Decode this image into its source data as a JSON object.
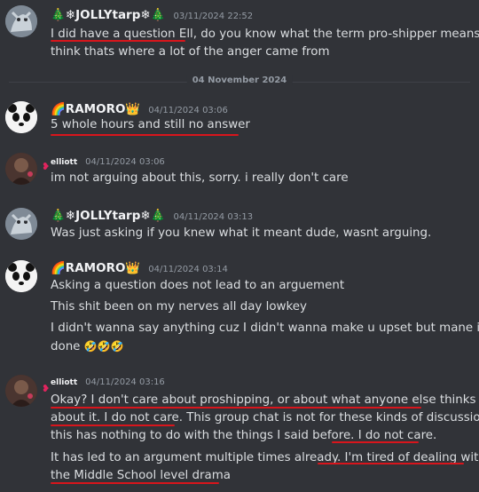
{
  "messages": [
    {
      "username": "🎄❄JOLLYtarp❄🎄",
      "timestamp": "03/11/2024 22:52",
      "lines": [
        "I did have a question Ell, do you know what the term pro-shipper means? I",
        "think thats where a lot of the anger came from"
      ]
    },
    {
      "username": "🌈RAMORO👑",
      "timestamp": "04/11/2024 03:06",
      "lines": [
        "5 whole hours and still no answer"
      ]
    },
    {
      "username": "elliott",
      "timestamp": "04/11/2024 03:06",
      "lines": [
        "im not arguing about this, sorry. i really don't care"
      ]
    },
    {
      "username": "🎄❄JOLLYtarp❄🎄",
      "timestamp": "04/11/2024 03:13",
      "lines": [
        "Was just asking if you knew what it meant dude, wasnt arguing."
      ]
    },
    {
      "username": "🌈RAMORO👑",
      "timestamp": "04/11/2024 03:14",
      "lines": [
        "Asking a question does not lead to an arguement",
        "This shit been on my nerves all day lowkey",
        "I didn't wanna say anything cuz I didn't wanna make u upset but mane im",
        "done"
      ],
      "trailing_emoji": "🤣🤣🤣"
    },
    {
      "username": "elliott",
      "timestamp": "04/11/2024 03:16",
      "lines": [
        "Okay? I don't care about proshipping, or about what anyone else thinks",
        "about it. I do not care. This group chat is not for these kinds of discussions,",
        "this has nothing to do with the things I said before. I do not care.",
        "It has led to an argument multiple times already. I'm tired of dealing with",
        "the Middle School level drama"
      ]
    }
  ],
  "date_divider": "04 November 2024",
  "colors": {
    "background": "#313338",
    "text": "#dbdee1",
    "username": "#f2f3f5",
    "timestamp": "#949ba4",
    "underline": "#d8151c"
  },
  "icons": {
    "jolly_avatar": "gray-creature-avatar",
    "ramoro_avatar": "panda-avatar",
    "elliott_avatar": "dark-character-avatar",
    "elliott_badge": "hearts-icon"
  }
}
